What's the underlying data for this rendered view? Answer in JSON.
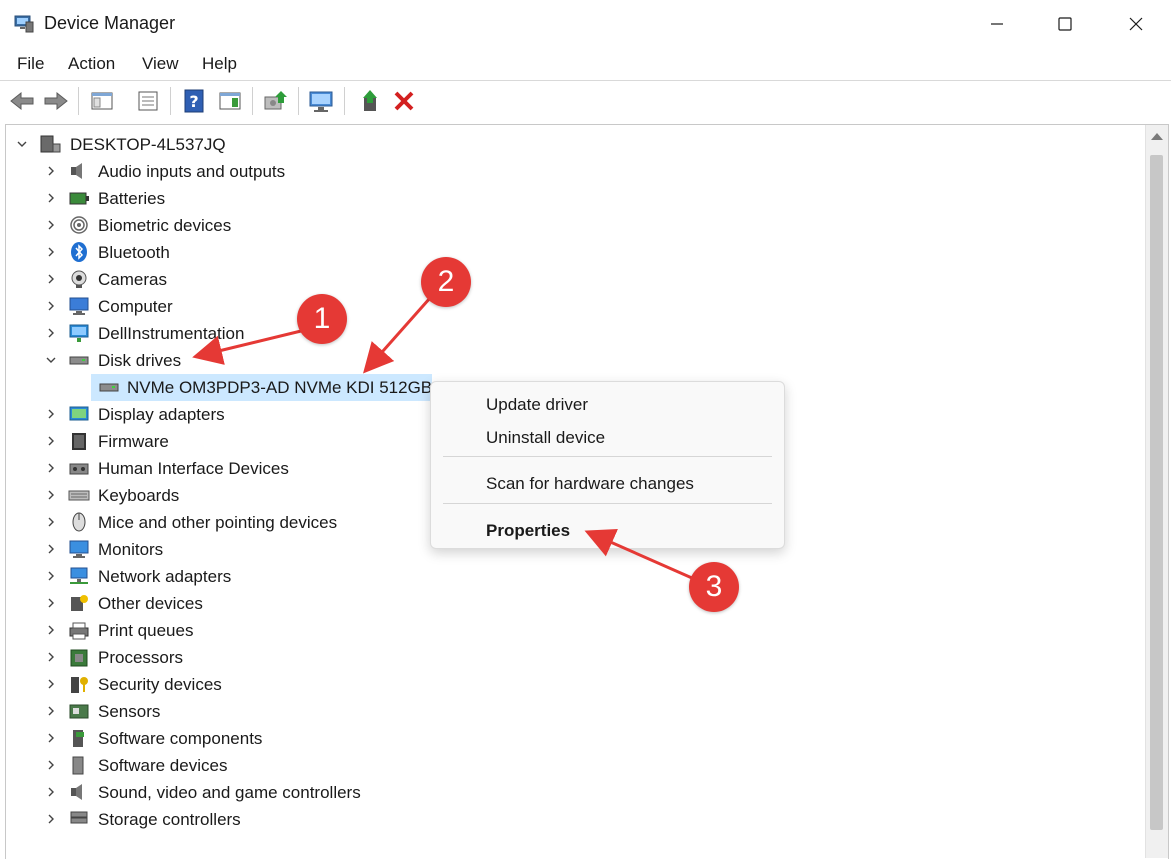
{
  "window": {
    "title": "Device Manager"
  },
  "menu": {
    "file": "File",
    "action": "Action",
    "view": "View",
    "help": "Help"
  },
  "toolbar": {
    "icons": [
      "back-icon",
      "forward-icon",
      "show-hide-tree-icon",
      "properties-icon",
      "help-icon",
      "action-pane-icon",
      "update-driver-icon",
      "scan-hardware-icon",
      "enable-device-icon",
      "uninstall-icon"
    ]
  },
  "tree": {
    "root": "DESKTOP-4L537JQ",
    "categories": [
      "Audio inputs and outputs",
      "Batteries",
      "Biometric devices",
      "Bluetooth",
      "Cameras",
      "Computer",
      "DellInstrumentation",
      "Disk drives",
      "Display adapters",
      "Firmware",
      "Human Interface Devices",
      "Keyboards",
      "Mice and other pointing devices",
      "Monitors",
      "Network adapters",
      "Other devices",
      "Print queues",
      "Processors",
      "Security devices",
      "Sensors",
      "Software components",
      "Software devices",
      "Sound, video and game controllers",
      "Storage controllers"
    ],
    "disk_drive_child": "NVMe OM3PDP3-AD NVMe KDI 512GB"
  },
  "context_menu": {
    "update_driver": "Update driver",
    "uninstall_device": "Uninstall device",
    "scan_hardware": "Scan for hardware changes",
    "properties": "Properties"
  },
  "annotations": {
    "badge1": "1",
    "badge2": "2",
    "badge3": "3"
  },
  "colors": {
    "selection": "#cce8ff",
    "annotation_red": "#e53935"
  }
}
